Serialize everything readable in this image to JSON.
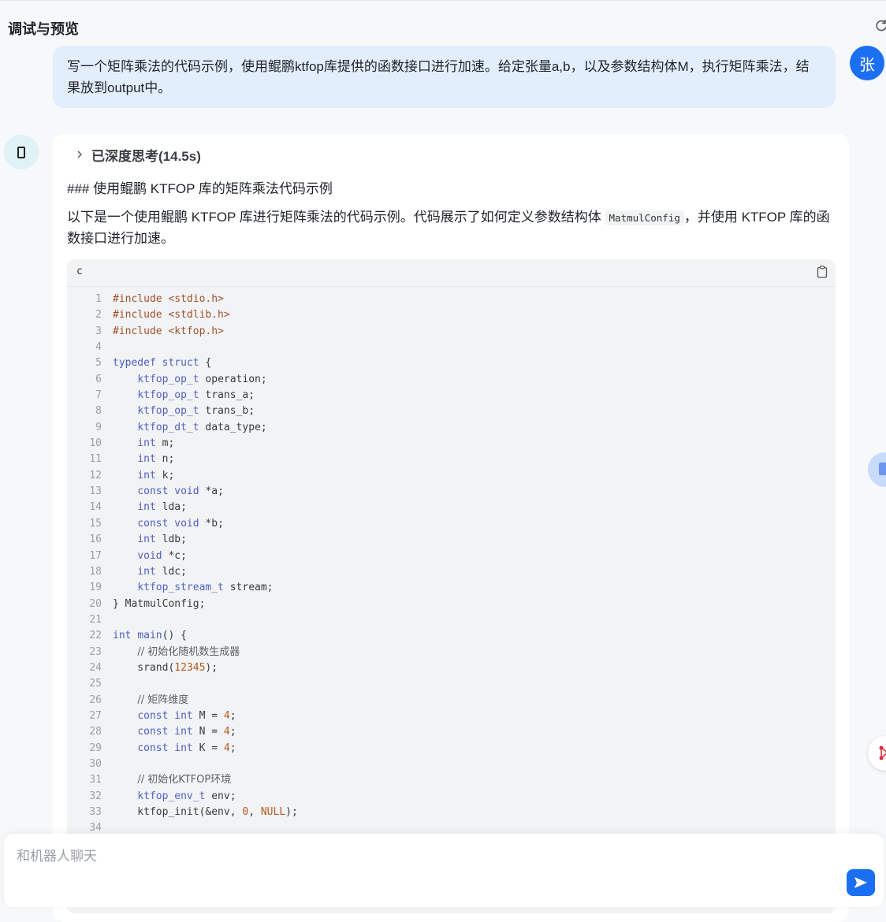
{
  "header": {
    "title": "调试与预览"
  },
  "user_message": {
    "avatar_text": "张",
    "text": "写一个矩阵乘法的代码示例，使用鲲鹏ktfop库提供的函数接口进行加速。给定张量a,b，以及参数结构体M，执行矩阵乘法，结果放到output中。"
  },
  "bot_message": {
    "thinking_label": "已深度思考(14.5s)",
    "heading": "### 使用鲲鹏 KTFOP 库的矩阵乘法代码示例",
    "para_before": "以下是一个使用鲲鹏 KTFOP 库进行矩阵乘法的代码示例。代码展示了如何定义参数结构体 ",
    "para_code": "MatmulConfig",
    "para_after": "，并使用 KTFOP 库的函数接口进行加速。",
    "code": {
      "language": "c",
      "lines": [
        {
          "n": "1",
          "t": "#include <stdio.h>"
        },
        {
          "n": "2",
          "t": "#include <stdlib.h>"
        },
        {
          "n": "3",
          "t": "#include <ktfop.h>"
        },
        {
          "n": "4",
          "t": ""
        },
        {
          "n": "5",
          "t": "typedef struct {"
        },
        {
          "n": "6",
          "t": "    ktfop_op_t operation;"
        },
        {
          "n": "7",
          "t": "    ktfop_op_t trans_a;"
        },
        {
          "n": "8",
          "t": "    ktfop_op_t trans_b;"
        },
        {
          "n": "9",
          "t": "    ktfop_dt_t data_type;"
        },
        {
          "n": "10",
          "t": "    int m;"
        },
        {
          "n": "11",
          "t": "    int n;"
        },
        {
          "n": "12",
          "t": "    int k;"
        },
        {
          "n": "13",
          "t": "    const void *a;"
        },
        {
          "n": "14",
          "t": "    int lda;"
        },
        {
          "n": "15",
          "t": "    const void *b;"
        },
        {
          "n": "16",
          "t": "    int ldb;"
        },
        {
          "n": "17",
          "t": "    void *c;"
        },
        {
          "n": "18",
          "t": "    int ldc;"
        },
        {
          "n": "19",
          "t": "    ktfop_stream_t stream;"
        },
        {
          "n": "20",
          "t": "} MatmulConfig;"
        },
        {
          "n": "21",
          "t": ""
        },
        {
          "n": "22",
          "t": "int main() {"
        },
        {
          "n": "23",
          "t": "    // 初始化随机数生成器"
        },
        {
          "n": "24",
          "t": "    srand(12345);"
        },
        {
          "n": "25",
          "t": ""
        },
        {
          "n": "26",
          "t": "    // 矩阵维度"
        },
        {
          "n": "27",
          "t": "    const int M = 4;"
        },
        {
          "n": "28",
          "t": "    const int N = 4;"
        },
        {
          "n": "29",
          "t": "    const int K = 4;"
        },
        {
          "n": "30",
          "t": ""
        },
        {
          "n": "31",
          "t": "    // 初始化KTFOP环境"
        },
        {
          "n": "32",
          "t": "    ktfop_env_t env;"
        },
        {
          "n": "33",
          "t": "    ktfop_init(&env, 0, NULL);"
        },
        {
          "n": "34",
          "t": ""
        }
      ]
    }
  },
  "composer": {
    "placeholder": "和机器人聊天"
  },
  "colors": {
    "accent": "#1a6ff2",
    "user_bubble": "#e3eefc",
    "code_bg": "#f2f3f5"
  }
}
